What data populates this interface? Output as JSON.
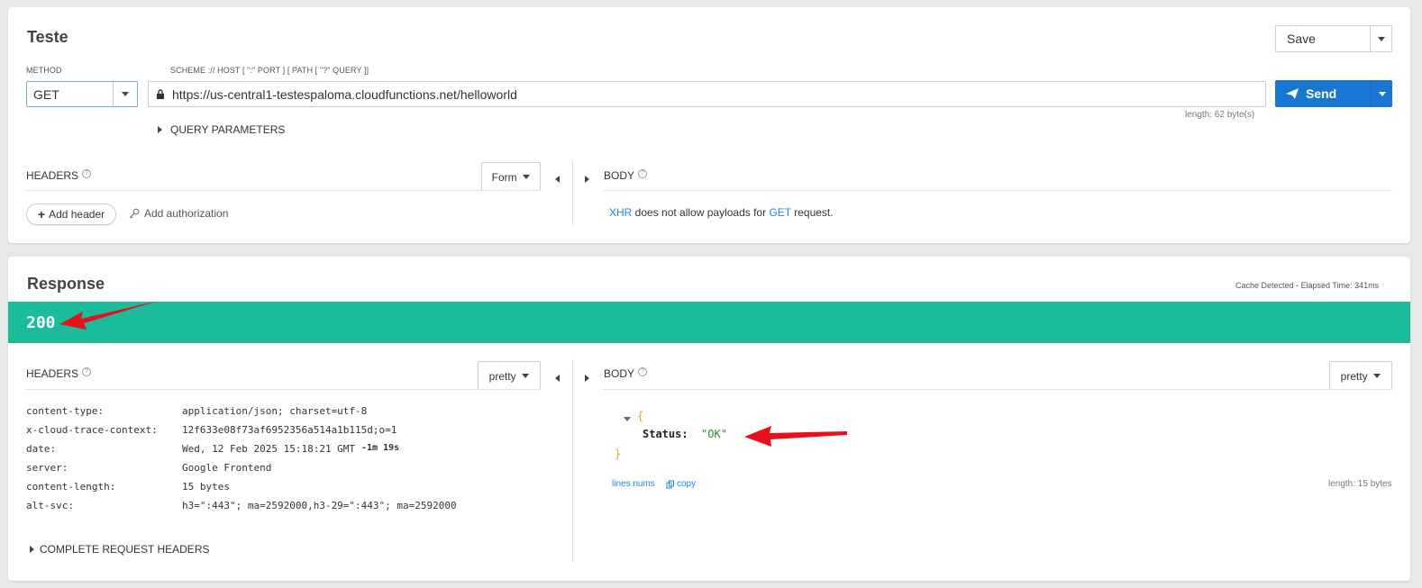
{
  "request": {
    "title": "Teste",
    "save_label": "Save",
    "method_label": "METHOD",
    "method_value": "GET",
    "url_label": "SCHEME :// HOST [ \":\" PORT ] [ PATH [ \"?\" QUERY ]]",
    "url_value": "https://us-central1-testespaloma.cloudfunctions.net/helloworld",
    "url_length": "length: 62 byte(s)",
    "send_label": "Send",
    "query_params_label": "QUERY PARAMETERS",
    "headers_label": "HEADERS",
    "headers_mode": "Form",
    "add_header_label": "Add header",
    "add_auth_label": "Add authorization",
    "body_label": "BODY",
    "body_msg_xhr": "XHR",
    "body_msg_mid": " does not allow payloads for ",
    "body_msg_get": "GET",
    "body_msg_end": " request."
  },
  "response": {
    "title": "Response",
    "cache_info": "Cache Detected - Elapsed Time: 341ms",
    "status_code": "200",
    "headers_label": "HEADERS",
    "headers_mode": "pretty",
    "body_label": "BODY",
    "body_mode": "pretty",
    "headers": [
      {
        "name": "content-type:",
        "value": "application/json; charset=utf-8",
        "extra": ""
      },
      {
        "name": "x-cloud-trace-context:",
        "value": "12f633e08f73af6952356a514a1b115d;o=1",
        "extra": ""
      },
      {
        "name": "date:",
        "value": "Wed, 12 Feb 2025 15:18:21 GMT",
        "extra": "-1m 19s"
      },
      {
        "name": "server:",
        "value": "Google Frontend",
        "extra": ""
      },
      {
        "name": "content-length:",
        "value": "15 bytes",
        "extra": ""
      },
      {
        "name": "alt-svc:",
        "value": "h3=\":443\"; ma=2592000,h3-29=\":443\"; ma=2592000",
        "extra": ""
      }
    ],
    "complete_headers_label": "COMPLETE REQUEST HEADERS",
    "json_open": "{",
    "json_key": "Status:",
    "json_value": "\"OK\"",
    "json_close": "}",
    "lines_nums_label": "lines nums",
    "copy_label": "copy",
    "body_length": "length: 15 bytes"
  },
  "colors": {
    "status_bar": "#1abc9c",
    "send_button": "#1976d2",
    "annotation_arrow": "#e8101a"
  }
}
